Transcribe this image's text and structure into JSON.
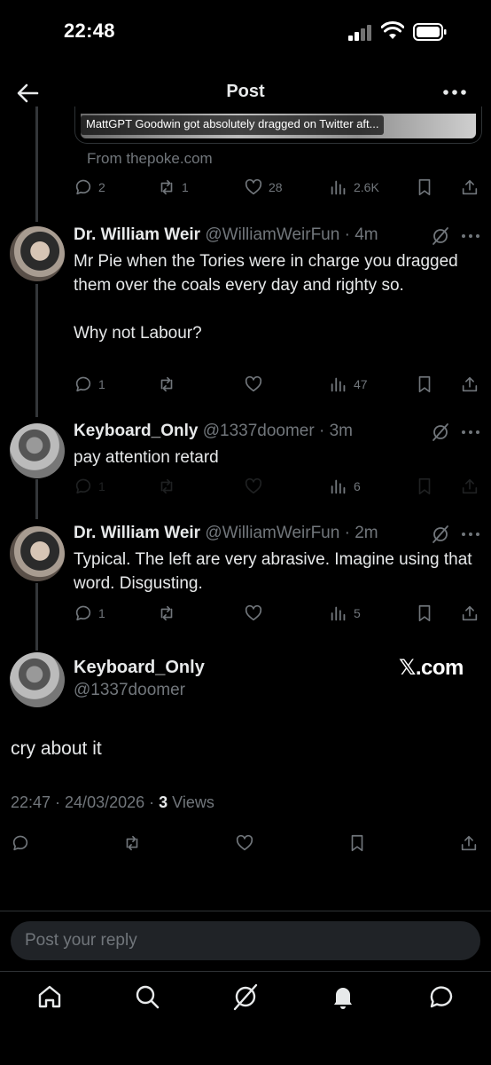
{
  "status_bar": {
    "time": "22:48"
  },
  "header": {
    "title": "Post"
  },
  "link_card": {
    "caption": "MattGPT Goodwin got absolutely dragged on Twitter aft...",
    "source": "From thepoke.com",
    "stats": {
      "replies": "2",
      "reposts": "1",
      "likes": "28",
      "views": "2.6K"
    }
  },
  "replies": [
    {
      "name": "Dr. William Weir",
      "handle": "@WilliamWeirFun",
      "time": "4m",
      "text": "Mr Pie when the Tories were in charge you dragged them over the coals every day and righty so.\n\nWhy not Labour?",
      "stats": {
        "replies": "1",
        "views": "47"
      }
    },
    {
      "name": "Keyboard_Only",
      "handle": "@1337doomer",
      "time": "3m",
      "text": "pay attention retard",
      "stats": {
        "replies": "1",
        "views": "6"
      }
    },
    {
      "name": "Dr. William Weir",
      "handle": "@WilliamWeirFun",
      "time": "2m",
      "text": "Typical. The left are very abrasive. Imagine using that word. Disgusting.",
      "stats": {
        "replies": "1",
        "views": "5"
      }
    }
  ],
  "main_post": {
    "name": "Keyboard_Only",
    "handle": "@1337doomer",
    "watermark": "𝕏.com",
    "text": "cry about it",
    "timestamp": "22:47 · 24/03/2026 · ",
    "views_count": "3",
    "views_label": " Views"
  },
  "reply_box": {
    "placeholder": "Post your reply"
  },
  "separator": "·",
  "icons": [
    "back-arrow-icon",
    "more-icon",
    "reply-icon",
    "repost-icon",
    "like-icon",
    "views-icon",
    "bookmark-icon",
    "share-icon",
    "grok-icon",
    "home-icon",
    "search-icon",
    "grok-icon",
    "notifications-icon",
    "messages-icon"
  ],
  "colors": {
    "background": "#000000",
    "text": "#e7e9ea",
    "muted": "#71767b",
    "border": "#2f3336"
  }
}
